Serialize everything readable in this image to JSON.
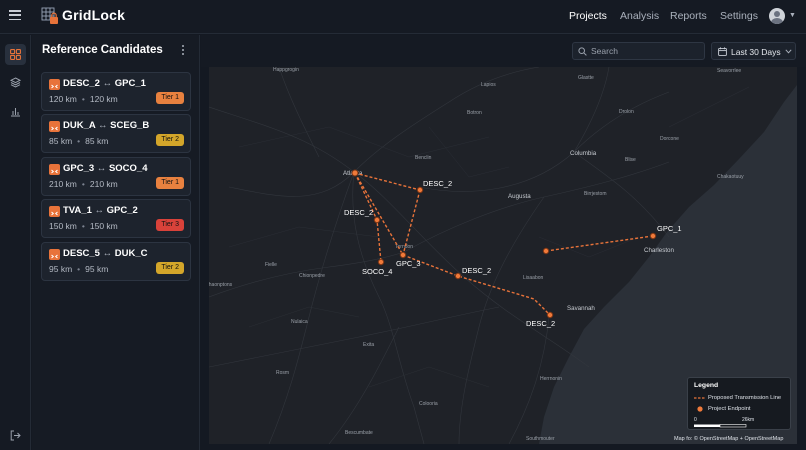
{
  "app": {
    "name": "GridLock"
  },
  "nav": [
    {
      "label": "Projects",
      "active": true
    },
    {
      "label": "Analysis",
      "active": false
    },
    {
      "label": "Reports",
      "active": false
    },
    {
      "label": "Settings",
      "active": false
    }
  ],
  "sidebar": {
    "title": "Reference Candidates",
    "cards": [
      {
        "from": "DESC_2",
        "arrow": "↔",
        "to": "GPC_1",
        "dist_a": "120 km",
        "dist_b": "120 km",
        "tier": "Tier 1",
        "tier_color": "#e8813f"
      },
      {
        "from": "DUK_A",
        "arrow": "↔",
        "to": "SCEG_B",
        "dist_a": "85 km",
        "dist_b": "85 km",
        "tier": "Tier 2",
        "tier_color": "#d4a62a"
      },
      {
        "from": "GPC_3",
        "arrow": "↔",
        "to": "SOCO_4",
        "dist_a": "210 km",
        "dist_b": "210 km",
        "tier": "Tier 1",
        "tier_color": "#e8813f"
      },
      {
        "from": "TVA_1",
        "arrow": "↔",
        "to": "GPC_2",
        "dist_a": "150 km",
        "dist_b": "150 km",
        "tier": "Tier 3",
        "tier_color": "#d9423a"
      },
      {
        "from": "DESC_5",
        "arrow": "↔",
        "to": "DUK_C",
        "dist_a": "95 km",
        "dist_b": "95 km",
        "tier": "Tier 2",
        "tier_color": "#d4a62a"
      }
    ],
    "separator": "•"
  },
  "toolbar": {
    "search_placeholder": "Search",
    "date_range": "Last 30 Days"
  },
  "map": {
    "route_labels": {
      "desc2_ne": "DESC_2",
      "desc2_w": "DESC_2",
      "gpc3": "GPC_3",
      "soco4": "SOCO_4",
      "desc2_mid": "DESC_2",
      "desc2_se": "DESC_2",
      "gpc1": "GPC_1"
    },
    "place_labels": {
      "happgrogin": "Happgrogin",
      "lapios": "Lapios",
      "botron": "Botron",
      "glastte": "Glastte",
      "seavorrlee": "Seavorrlee",
      "drolon": "Drolon",
      "dorcone": "Dorcone",
      "benclin": "Benclin",
      "columbia": "Columbia",
      "blise": "Blise",
      "atlanta": "Atlanta",
      "augusta": "Augusta",
      "birrjestom": "Birrjestom",
      "chakaotuuy": "Chakaotuuy",
      "torndon": "Torndon",
      "charleston": "Charleston",
      "fielle": "Fielle",
      "chionpedre": "Chionpedre",
      "lisaabon": "Lisaabon",
      "hhaonptons": "hhaonptons",
      "savannah": "Savannah",
      "nulaica": "Nulaica",
      "exita": "Exita",
      "rosm": "Rosm",
      "herrnonin": "Herrnonin",
      "colooria": "Colooria",
      "bescumbate": "Bescumbate",
      "southmouter": "Southmouter"
    },
    "colors": {
      "route": "#e8733a",
      "endpoint": "#f07a3a",
      "land": "#1f2228",
      "sea": "#2a2f36",
      "road": "#3a3e45"
    }
  },
  "legend": {
    "title": "Legend",
    "line_label": "Proposed Transmission Line",
    "point_label": "Project Endpoint",
    "scale_min": "0",
    "scale_max": "26km"
  },
  "attribution": "Map fo: © OpenStreetMap + OpenStreetMap"
}
